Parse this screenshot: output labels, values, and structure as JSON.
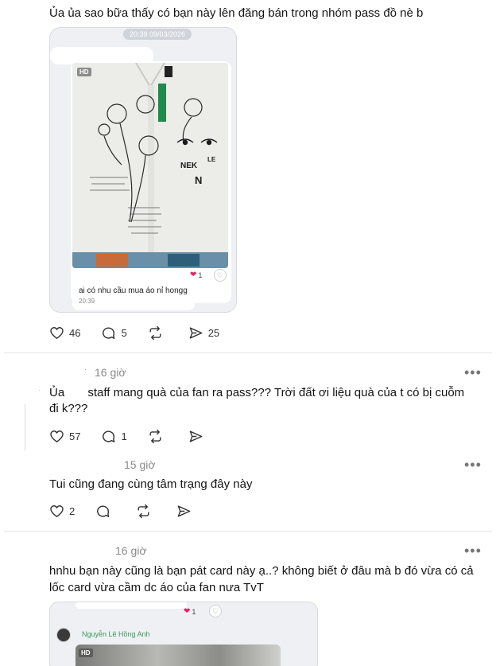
{
  "post": {
    "text": "Ủa ủa sao bữa thấy có bạn này lên đăng bán trong nhóm pass đồ nè b",
    "screenshot": {
      "timestamp": "20:39 09/03/2026",
      "hd_label": "HD",
      "reaction_count": "1",
      "message": "ai có nhu cầu mua áo nỉ hongg",
      "message_time": "20:39"
    },
    "stats": {
      "likes": "46",
      "comments": "5",
      "reposts": "",
      "shares": "25"
    }
  },
  "reply1": {
    "time": "16 giờ",
    "text_line1": "Ủa       staff mang quà của fan ra pass??? Trời đất ơi liệu quà của t có bị cuỗm",
    "text_line2": "đi k???",
    "stats": {
      "likes": "57",
      "comments": "1"
    }
  },
  "reply2": {
    "time": "15 giờ",
    "text": "Tui cũng đang cùng tâm trạng đây này",
    "stats": {
      "likes": "2"
    }
  },
  "reply3": {
    "time": "16 giờ",
    "text_line1": "hnhu bạn này cũng là bạn pát card này ạ..? không biết ở đâu mà b đó vừa có cả",
    "text_line2": "lốc card vừa cầm dc áo của fan nưa TvT",
    "screenshot": {
      "reaction_count": "1",
      "sender_name": "Nguyễn Lê Hồng Anh",
      "hd_label": "HD"
    }
  },
  "icons": {
    "more": "•••"
  }
}
